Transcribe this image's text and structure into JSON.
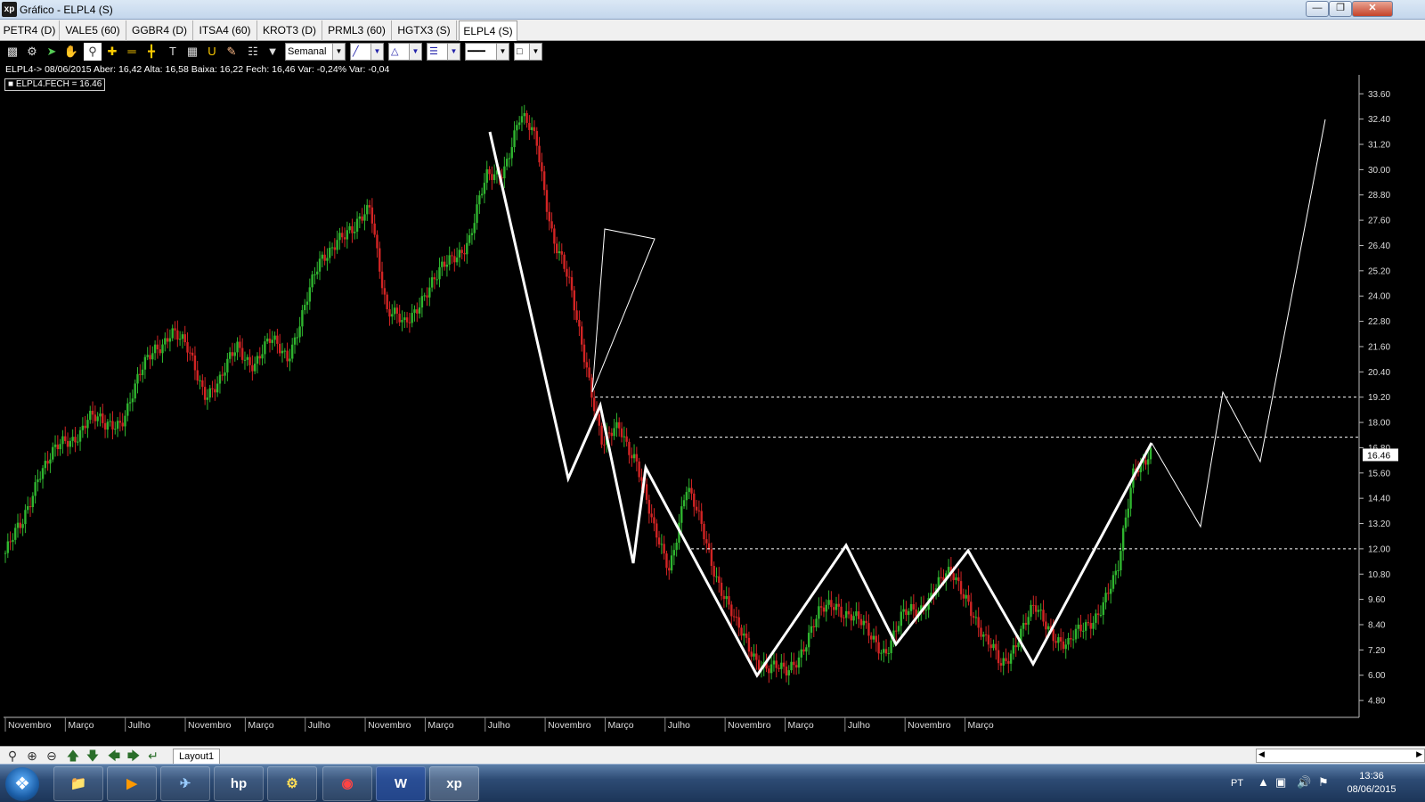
{
  "window": {
    "title": "Gráfico - ELPL4 (S)",
    "app_icon": "xp"
  },
  "tabs": [
    "PETR4 (D)",
    "VALE5 (60)",
    "GGBR4 (D)",
    "ITSA4 (60)",
    "KROT3 (D)",
    "PRML3 (60)",
    "HGTX3 (S)",
    "ELPL4 (S)"
  ],
  "active_tab": 7,
  "toolbar": {
    "period_value": "Semanal"
  },
  "info_line": "ELPL4-> 08/06/2015 Aber: 16,42 Alta: 16,58 Baixa: 16,22 Fech: 16,46 Var: -0,24% Var: -0,04",
  "legend_label": "ELPL4.FECH = 16.46",
  "chart_data": {
    "type": "candlestick",
    "series": [
      {
        "name": "ELPL4.FECH",
        "last_value": 16.46
      }
    ],
    "last_value_label": "16.46",
    "y_ticks": [
      "4.80",
      "6.00",
      "7.20",
      "8.40",
      "9.60",
      "10.80",
      "12.00",
      "13.20",
      "14.40",
      "15.60",
      "16.80",
      "18.00",
      "19.20",
      "20.40",
      "21.60",
      "22.80",
      "24.00",
      "25.20",
      "26.40",
      "27.60",
      "28.80",
      "30.00",
      "31.20",
      "32.40",
      "33.60"
    ],
    "ylim": [
      4.0,
      34.5
    ],
    "x_ticks": [
      "Novembro",
      "Março",
      "Julho",
      "Novembro",
      "Março",
      "Julho",
      "Novembro",
      "Março",
      "Julho",
      "Novembro",
      "Março",
      "Julho",
      "Novembro",
      "Março",
      "Julho",
      "Novembro",
      "Março"
    ],
    "horizontal_levels": [
      19.2,
      17.3,
      12.0
    ],
    "close_path": [
      11.8,
      13.0,
      15.8,
      16.5,
      17.2,
      18.4,
      17.6,
      18.3,
      19.9,
      21.5,
      22.5,
      21.2,
      19.6,
      19.9,
      21.6,
      20.9,
      21.7,
      21.3,
      23.3,
      25.6,
      27.0,
      26.8,
      28.5,
      23.2,
      22.5,
      24.0,
      24.7,
      26.0,
      26.8,
      29.5,
      30.2,
      32.3,
      31.5,
      26.8,
      24.3,
      21.0,
      16.7,
      17.8,
      16.4,
      12.8,
      11.3,
      14.8,
      12.9,
      10.5,
      8.2,
      7.2,
      6.3,
      6.0,
      7.4,
      8.7,
      9.5,
      8.9,
      7.8,
      7.3,
      8.6,
      9.1,
      10.3,
      10.6,
      9.8,
      7.5,
      6.5,
      7.9,
      9.0,
      8.3,
      7.3,
      8.2,
      9.4,
      10.6,
      16.1,
      16.5
    ]
  },
  "nav": {
    "layout_tab": "Layout1"
  },
  "taskbar": {
    "lang": "PT",
    "time": "13:36",
    "date": "08/06/2015"
  }
}
